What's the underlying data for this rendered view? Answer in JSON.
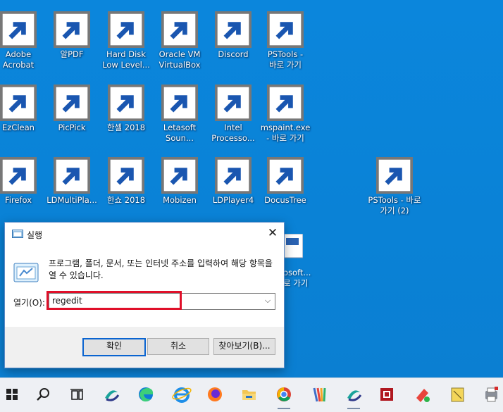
{
  "desktop_icons": [
    {
      "label": "Adobe Acrobat",
      "icon": "acrobat-icon"
    },
    {
      "label": "알PDF",
      "icon": "alpdf-icon"
    },
    {
      "label": "Hard Disk Low Level...",
      "icon": "hard-disk-tool-icon"
    },
    {
      "label": "Oracle VM VirtualBox",
      "icon": "virtualbox-icon"
    },
    {
      "label": "Discord",
      "icon": "discord-icon"
    },
    {
      "label": "PSTools - 바로 가기",
      "icon": "folder-icon"
    },
    {
      "label": "EzClean",
      "icon": "ezclean-icon"
    },
    {
      "label": "PicPick",
      "icon": "picpick-icon"
    },
    {
      "label": "한셀 2018",
      "icon": "hancell-icon"
    },
    {
      "label": "Letasoft Soun...",
      "icon": "speaker-icon"
    },
    {
      "label": "Intel Processo...",
      "icon": "document-icon"
    },
    {
      "label": "mspaint.exe - 바로 가기",
      "icon": "paint-icon"
    },
    {
      "label": "Firefox",
      "icon": "firefox-icon"
    },
    {
      "label": "LDMultiPla...",
      "icon": "ldmultiplayer-icon"
    },
    {
      "label": "한쇼 2018",
      "icon": "hanshow-icon"
    },
    {
      "label": "Mobizen",
      "icon": "mobizen-icon"
    },
    {
      "label": "LDPlayer4",
      "icon": "ldplayer-icon"
    },
    {
      "label": "DocusTree",
      "icon": "docustree-icon"
    },
    {
      "label": "PSTools - 바로 가기 (2)",
      "icon": "folder-icon"
    }
  ],
  "partial_icon_label": [
    "osoft...",
    "로 가기"
  ],
  "run_dialog": {
    "title": "실행",
    "close_glyph": "✕",
    "description": "프로그램, 폴더, 문서, 또는 인터넷 주소를 입력하여 해당 항목을 열 수 있습니다.",
    "open_label": "열기(O):",
    "input_value": "regedit",
    "buttons": {
      "ok": "확인",
      "cancel": "취소",
      "browse": "찾아보기(B)..."
    }
  },
  "taskbar": {
    "items": [
      "windows-start-icon",
      "search-icon",
      "task-view-icon",
      "app-icon",
      "edge-icon",
      "internet-explorer-icon",
      "firefox-icon",
      "file-explorer-icon",
      "chrome-icon",
      "picpick-icon",
      "app-icon",
      "paint-icon",
      "sticky-notes-icon",
      "hancom-icon",
      "printer-icon"
    ]
  },
  "colors": {
    "accent": "#0a84d8",
    "highlight": "#e0102a"
  }
}
